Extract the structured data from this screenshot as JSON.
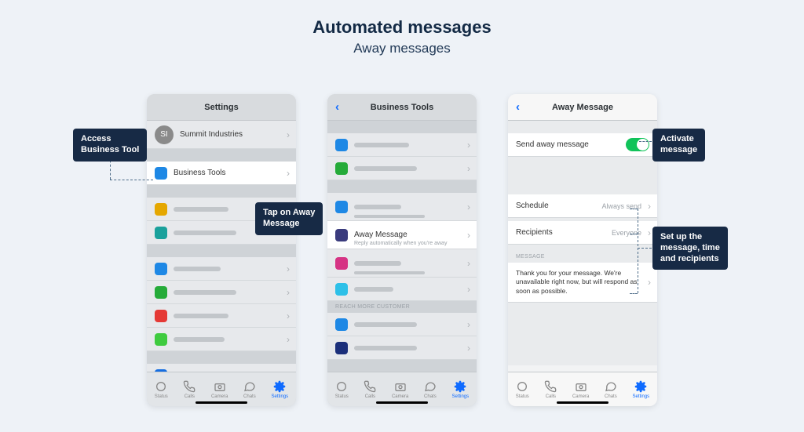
{
  "title": "Automated messages",
  "subtitle": "Away messages",
  "callouts": {
    "access": "Access\nBusiness Tool",
    "tapAway": "Tap on Away\nMessage",
    "activate": "Activate\nmessage",
    "setup": "Set up the\nmessage, time\nand recipients"
  },
  "phone1": {
    "header": "Settings",
    "avatarInitials": "SI",
    "businessName": "Summit Industries",
    "businessTools": "Business Tools"
  },
  "phone2": {
    "header": "Business Tools",
    "awayMessage": "Away Message",
    "awayMessageSub": "Reply automatically when you're away",
    "reachMore": "REACH MORE CUSTOMER"
  },
  "phone3": {
    "header": "Away Message",
    "sendAway": "Send away message",
    "schedule": "Schedule",
    "scheduleValue": "Always send",
    "recipients": "Recipients",
    "recipientsValue": "Everyone",
    "messageLabel": "MESSAGE",
    "messageText": "Thank you for your message. We're unavailable right now, but will respond as soon as possible."
  },
  "tabs": {
    "status": "Status",
    "calls": "Calls",
    "camera": "Camera",
    "chats": "Chats",
    "settings": "Settings"
  }
}
